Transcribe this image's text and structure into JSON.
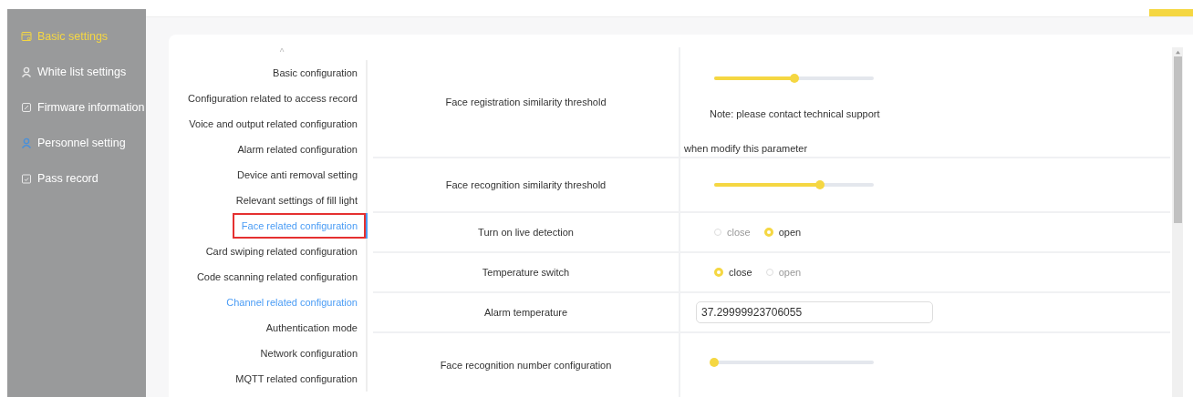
{
  "sidebar": {
    "items": [
      {
        "label": "Basic settings",
        "selected": true
      },
      {
        "label": "White list settings",
        "selected": false
      },
      {
        "label": "Firmware information",
        "selected": false
      },
      {
        "label": "Personnel setting",
        "selected": false
      },
      {
        "label": "Pass record",
        "selected": false
      }
    ]
  },
  "nav": {
    "scroll_up": "^",
    "items": [
      {
        "label": "Basic configuration",
        "selected": false,
        "hovered": false,
        "annotated": false
      },
      {
        "label": "Configuration related to access record",
        "selected": false,
        "hovered": false,
        "annotated": false
      },
      {
        "label": "Voice and output related configuration",
        "selected": false,
        "hovered": false,
        "annotated": false
      },
      {
        "label": "Alarm related configuration",
        "selected": false,
        "hovered": false,
        "annotated": false
      },
      {
        "label": "Device anti removal setting",
        "selected": false,
        "hovered": false,
        "annotated": false
      },
      {
        "label": "Relevant settings of fill light",
        "selected": false,
        "hovered": false,
        "annotated": false
      },
      {
        "label": "Face related configuration",
        "selected": true,
        "hovered": false,
        "annotated": true
      },
      {
        "label": "Card swiping related configuration",
        "selected": false,
        "hovered": false,
        "annotated": false
      },
      {
        "label": "Code scanning related configuration",
        "selected": false,
        "hovered": false,
        "annotated": false
      },
      {
        "label": "Channel related configuration",
        "selected": false,
        "hovered": true,
        "annotated": false
      },
      {
        "label": "Authentication mode",
        "selected": false,
        "hovered": false,
        "annotated": false
      },
      {
        "label": "Network configuration",
        "selected": false,
        "hovered": false,
        "annotated": false
      },
      {
        "label": "MQTT related configuration",
        "selected": false,
        "hovered": false,
        "annotated": false
      }
    ]
  },
  "settings": [
    {
      "kind": "slider",
      "label": "Face registration similarity threshold",
      "level": 0.5,
      "note": [
        "Note: please contact technical support",
        "when modify this parameter"
      ]
    },
    {
      "kind": "slider",
      "label": "Face recognition similarity threshold",
      "level": 0.66
    },
    {
      "kind": "radio",
      "label": "Turn on live detection",
      "options": [
        {
          "label": "close",
          "selected": false
        },
        {
          "label": "open",
          "selected": true
        }
      ]
    },
    {
      "kind": "radio",
      "label": "Temperature switch",
      "options": [
        {
          "label": "close",
          "selected": true
        },
        {
          "label": "open",
          "selected": false
        }
      ]
    },
    {
      "kind": "input",
      "label": "Alarm temperature",
      "value": "37.29999923706055"
    },
    {
      "kind": "slider",
      "label": "Face recognition number configuration",
      "level": 0
    }
  ]
}
